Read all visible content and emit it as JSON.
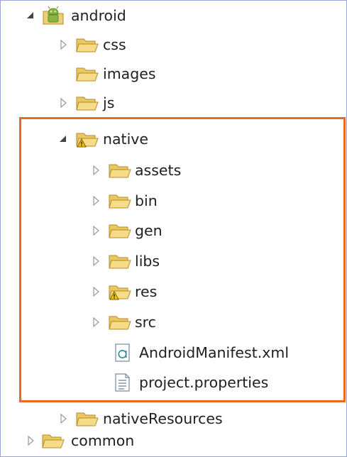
{
  "colors": {
    "highlight_border": "#ea6a1e",
    "frame_border": "#9aa7d8",
    "folder_fill": "#f3d87a",
    "folder_stroke": "#b88a2a",
    "text": "#1f1f1f"
  },
  "tree": {
    "root": {
      "label": "android",
      "expanded": true,
      "icon": "android-project-icon"
    },
    "items": [
      {
        "label": "css",
        "has_children": true,
        "expanded": false,
        "icon": "folder-icon"
      },
      {
        "label": "images",
        "has_children": false,
        "expanded": false,
        "icon": "folder-icon"
      },
      {
        "label": "js",
        "has_children": true,
        "expanded": false,
        "icon": "folder-icon"
      },
      {
        "label": "native",
        "has_children": true,
        "expanded": true,
        "icon": "folder-warning-icon"
      },
      {
        "label": "assets",
        "has_children": true,
        "expanded": false,
        "icon": "folder-icon"
      },
      {
        "label": "bin",
        "has_children": true,
        "expanded": false,
        "icon": "folder-icon"
      },
      {
        "label": "gen",
        "has_children": true,
        "expanded": false,
        "icon": "folder-icon"
      },
      {
        "label": "libs",
        "has_children": true,
        "expanded": false,
        "icon": "folder-icon"
      },
      {
        "label": "res",
        "has_children": true,
        "expanded": false,
        "icon": "folder-warning-icon"
      },
      {
        "label": "src",
        "has_children": true,
        "expanded": false,
        "icon": "folder-icon"
      },
      {
        "label": "AndroidManifest.xml",
        "has_children": false,
        "expanded": false,
        "icon": "xml-file-icon"
      },
      {
        "label": "project.properties",
        "has_children": false,
        "expanded": false,
        "icon": "text-file-icon"
      },
      {
        "label": "nativeResources",
        "has_children": true,
        "expanded": false,
        "icon": "folder-icon"
      },
      {
        "label": "common",
        "has_children": true,
        "expanded": false,
        "icon": "folder-icon"
      }
    ]
  }
}
